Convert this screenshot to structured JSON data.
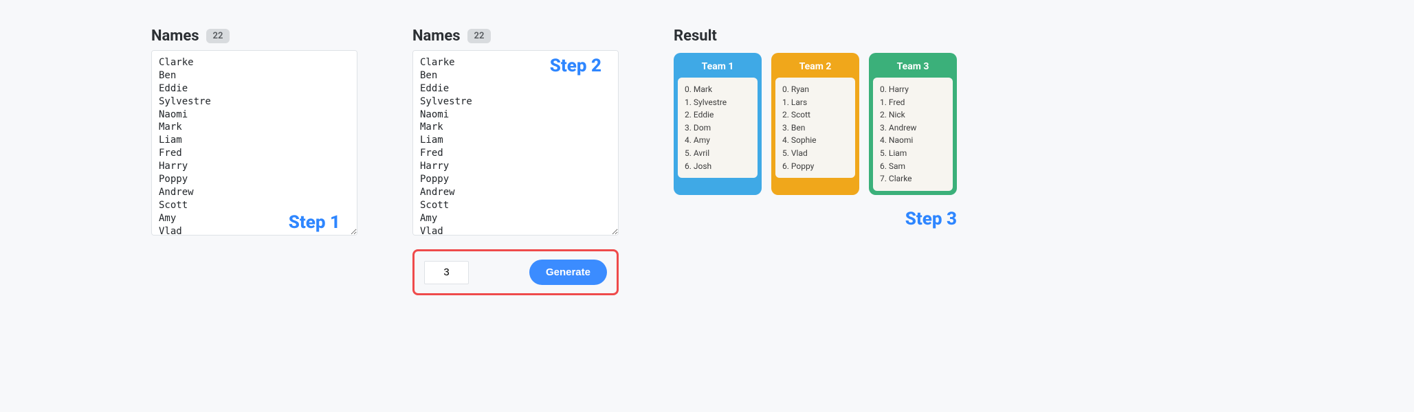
{
  "step_labels": {
    "step1": "Step 1",
    "step2": "Step 2",
    "step3": "Step 3"
  },
  "panel1": {
    "title": "Names",
    "count": "22",
    "names": "Clarke\nBen\nEddie\nSylvestre\nNaomi\nMark\nLiam\nFred\nHarry\nPoppy\nAndrew\nScott\nAmy\nVlad\nDom\nRyan"
  },
  "panel2": {
    "title": "Names",
    "count": "22",
    "names": "Clarke\nBen\nEddie\nSylvestre\nNaomi\nMark\nLiam\nFred\nHarry\nPoppy\nAndrew\nScott\nAmy\nVlad\nDom\nRyan",
    "team_count_value": "3",
    "generate_label": "Generate"
  },
  "result": {
    "title": "Result",
    "teams": [
      {
        "name": "Team 1",
        "color": "blue",
        "members": [
          "Mark",
          "Sylvestre",
          "Eddie",
          "Dom",
          "Amy",
          "Avril",
          "Josh"
        ]
      },
      {
        "name": "Team 2",
        "color": "orange",
        "members": [
          "Ryan",
          "Lars",
          "Scott",
          "Ben",
          "Sophie",
          "Vlad",
          "Poppy"
        ]
      },
      {
        "name": "Team 3",
        "color": "green",
        "members": [
          "Harry",
          "Fred",
          "Nick",
          "Andrew",
          "Naomi",
          "Liam",
          "Sam",
          "Clarke"
        ]
      }
    ]
  }
}
